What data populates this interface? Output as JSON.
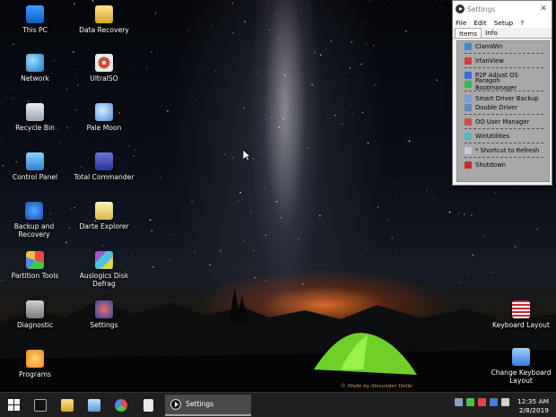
{
  "desktop": {
    "icons": [
      {
        "label": "This PC",
        "icon": "computer-icon"
      },
      {
        "label": "Data Recovery",
        "icon": "folder-icon"
      },
      {
        "label": "Network",
        "icon": "network-globe-icon"
      },
      {
        "label": "UltraISO",
        "icon": "disc-icon"
      },
      {
        "label": "Recycle Bin",
        "icon": "recycle-bin-icon"
      },
      {
        "label": "Pale Moon",
        "icon": "pale-moon-icon"
      },
      {
        "label": "Control Panel",
        "icon": "control-panel-icon"
      },
      {
        "label": "Total Commander",
        "icon": "floppy-icon"
      },
      {
        "label": "Backup and Recovery",
        "icon": "backup-icon"
      },
      {
        "label": "Darte Explorer",
        "icon": "explorer-icon"
      },
      {
        "label": "Partition Tools",
        "icon": "partition-pie-icon"
      },
      {
        "label": "Auslogics Disk Defrag",
        "icon": "defrag-cubes-icon"
      },
      {
        "label": "Diagnostic",
        "icon": "diagnostic-icon"
      },
      {
        "label": "Settings",
        "icon": "settings-icon"
      },
      {
        "label": "Programs",
        "icon": "programs-icon"
      },
      {
        "label": "Keyboard Layout",
        "icon": "flag-icon"
      },
      {
        "label": "Change Keyboard Layout",
        "icon": "keyboard-icon"
      }
    ],
    "credit": "© Made by Alexander Hetle"
  },
  "window": {
    "title": "Settings",
    "close_glyph": "✕",
    "menu": [
      "File",
      "Edit",
      "Setup",
      "?"
    ],
    "tabs": [
      "Items",
      "Info"
    ],
    "active_tab": "Items",
    "groups": [
      [
        {
          "label": "ClamWin",
          "color": "#3a8ad8"
        }
      ],
      [
        {
          "label": "IrfanView",
          "color": "#d83a3a"
        }
      ],
      [
        {
          "label": "P2P Adjust OS",
          "color": "#3a6ad8"
        },
        {
          "label": "Paragon Bootmanager",
          "color": "#3ab84a"
        }
      ],
      [
        {
          "label": "Smart Driver Backup",
          "color": "#7a9ad0"
        },
        {
          "label": "Double Driver",
          "color": "#5a8ac8"
        }
      ],
      [
        {
          "label": "OO User Manager",
          "color": "#d84a4a"
        }
      ],
      [
        {
          "label": "WinUtilities",
          "color": "#4ab8c8"
        }
      ],
      [
        {
          "label": "* Shortcut to Refresh",
          "color": "#c8c8d8"
        }
      ],
      [
        {
          "label": "Shutdown",
          "color": "#c82a2a"
        }
      ]
    ]
  },
  "taskbar": {
    "pinned": [
      "start-icon",
      "terminal-icon",
      "file-explorer-icon",
      "notepad-icon",
      "paint-icon",
      "document-icon"
    ],
    "active_app": "Settings",
    "tray_colors": [
      "#8aa0c0",
      "#4ac24a",
      "#d84a4a",
      "#4a7ad8",
      "#d0d0d0"
    ],
    "time": "12:35 AM",
    "date": "2/8/2019"
  }
}
